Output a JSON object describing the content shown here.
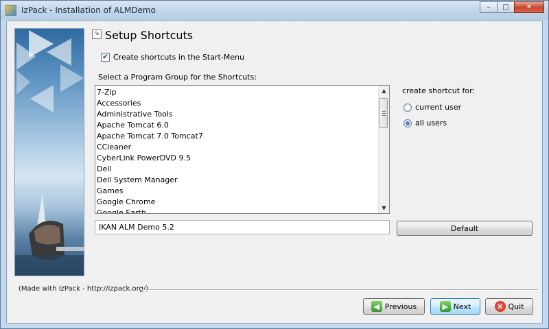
{
  "window": {
    "title": "IzPack - Installation of ALMDemo",
    "controls": {
      "minimize": "–",
      "maximize": "□",
      "close": "✕"
    }
  },
  "panel": {
    "title": "Setup Shortcuts",
    "title_icon": "⇘"
  },
  "start_menu_checkbox": {
    "label": "Create shortcuts in the Start-Menu",
    "checked": true,
    "mark": "✔"
  },
  "program_group": {
    "label": "Select a Program Group for the Shortcuts:",
    "items": [
      "7-Zip",
      "Accessories",
      "Administrative Tools",
      "Apache Tomcat 6.0",
      "Apache Tomcat 7.0 Tomcat7",
      "CCleaner",
      "CyberLink PowerDVD 9.5",
      "Dell",
      "Dell System Manager",
      "Games",
      "Google Chrome",
      "Google Earth"
    ],
    "input_value": "IKAN ALM Demo 5.2",
    "default_button": "Default",
    "scroll_up": "▲",
    "scroll_down": "▼"
  },
  "shortcut_for": {
    "label": "create shortcut for:",
    "options": [
      {
        "label": "current user",
        "selected": false
      },
      {
        "label": "all users",
        "selected": true
      }
    ]
  },
  "footer": {
    "made_with": "(Made with IzPack - http://izpack.org/)"
  },
  "nav": {
    "previous": "Previous",
    "next": "Next",
    "quit": "Quit",
    "previous_glyph": "◀",
    "next_glyph": "▶",
    "quit_glyph": "✕"
  },
  "colors": {
    "accent": "#3c7fb1",
    "titlebar": "#c3d6ea",
    "close_button": "#c7442b"
  }
}
